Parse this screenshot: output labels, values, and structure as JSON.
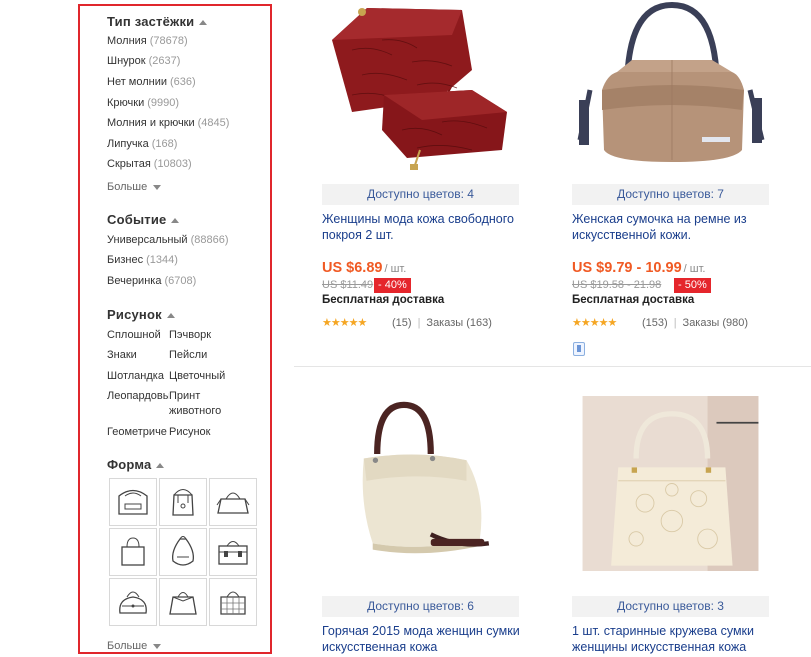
{
  "sidebar": {
    "clasp": {
      "title": "Тип застёжки",
      "items": [
        {
          "label": "Молния",
          "count": "(78678)"
        },
        {
          "label": "Шнурок",
          "count": "(2637)"
        },
        {
          "label": "Нет молнии",
          "count": "(636)"
        },
        {
          "label": "Крючки",
          "count": "(9990)"
        },
        {
          "label": "Молния и крючки",
          "count": "(4845)"
        },
        {
          "label": "Липучка",
          "count": "(168)"
        },
        {
          "label": "Скрытая",
          "count": "(10803)"
        }
      ],
      "more": "Больше"
    },
    "occasion": {
      "title": "Событие",
      "items": [
        {
          "label": "Универсальный",
          "count": "(88866)"
        },
        {
          "label": "Бизнес",
          "count": "(1344)"
        },
        {
          "label": "Вечеринка",
          "count": "(6708)"
        }
      ]
    },
    "pattern": {
      "title": "Рисунок",
      "items": [
        "Сплошной",
        "Пэчворк",
        "Знаки",
        "Пейсли",
        "Шотландка",
        "Цветочный",
        "Леопардовы",
        "Принт животного",
        "Геометриче",
        "Рисунок"
      ]
    },
    "shape": {
      "title": "Форма",
      "icons": [
        "clutch-bag-icon",
        "bucket-bag-icon",
        "trapeze-bag-icon",
        "tote-bag-icon",
        "hobo-bag-icon",
        "satchel-bag-icon",
        "bowling-bag-icon",
        "doctor-bag-icon",
        "plaid-tote-icon"
      ],
      "more": "Больше"
    }
  },
  "products": [
    {
      "image": "red-croc-bag-set-image",
      "colors": "Доступно цветов: 4",
      "title": "Женщины мода кожа свободного покроя 2 шт.",
      "price": "US $6.89",
      "unit": "/ шт.",
      "old_price": "US $11.49",
      "discount": "- 40%",
      "shipping": "Бесплатная доставка",
      "stars": "★★★★★",
      "rating_count": "(15)",
      "orders": "Заказы (163)"
    },
    {
      "image": "brown-leather-shoulder-bag-image",
      "colors": "Доступно цветов: 7",
      "title": "Женская сумочка на ремне из искусственной кожи.",
      "price": "US $9.79 - 10.99",
      "unit": "/ шт.",
      "old_price": "US $19.58 - 21.98",
      "discount": "- 50%",
      "shipping": "Бесплатная доставка",
      "stars": "★★★★★",
      "rating_count": "(153)",
      "orders": "Заказы (980)"
    },
    {
      "image": "cream-leather-hobo-bag-image",
      "colors": "Доступно цветов: 6",
      "title": "Горячая 2015 мода женщин сумки искусственная кожа"
    },
    {
      "image": "vintage-lace-handbag-image",
      "colors": "Доступно цветов: 3",
      "title": "1 шт. старинные кружева сумки женщины искусственная кожа"
    }
  ],
  "colors": {
    "sidebar_border": "#e0262c",
    "price": "#f05a24",
    "discount_bg": "#e5262c",
    "link": "#1a3e8c",
    "stars": "#f5a623"
  }
}
